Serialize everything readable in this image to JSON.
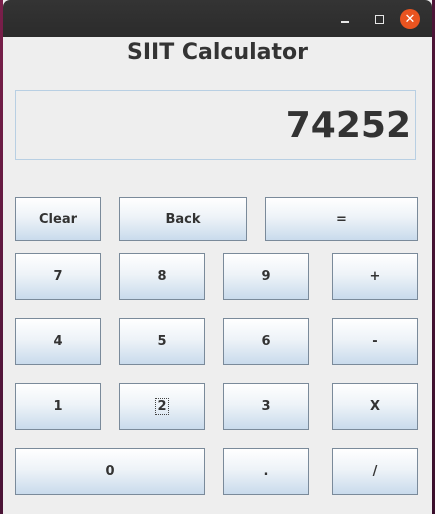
{
  "window": {
    "controls": {
      "minimize_icon": "minimize-icon",
      "maximize_icon": "maximize-icon",
      "close_icon": "close-icon",
      "close_glyph": "✕"
    }
  },
  "app": {
    "title": "SIIT Calculator",
    "display_value": "74252"
  },
  "buttons": {
    "clear": "Clear",
    "back": "Back",
    "equals": "=",
    "seven": "7",
    "eight": "8",
    "nine": "9",
    "plus": "+",
    "four": "4",
    "five": "5",
    "six": "6",
    "minus": "-",
    "one": "1",
    "two": "2",
    "three": "3",
    "multiply": "X",
    "zero": "0",
    "dot": ".",
    "divide": "/"
  }
}
